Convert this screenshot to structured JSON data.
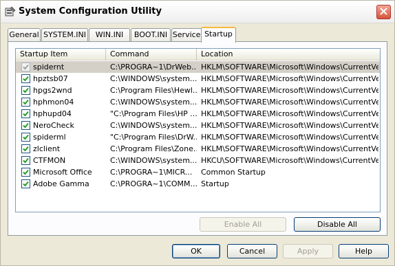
{
  "window": {
    "title": "System Configuration Utility",
    "app_icon": "msconfig-icon",
    "close_icon": "close-icon",
    "close_color": "#d6543b"
  },
  "tabs": [
    {
      "label": "General",
      "active": false
    },
    {
      "label": "SYSTEM.INI",
      "active": false
    },
    {
      "label": "WIN.INI",
      "active": false
    },
    {
      "label": "BOOT.INI",
      "active": false
    },
    {
      "label": "Services",
      "active": false
    },
    {
      "label": "Startup",
      "active": true
    }
  ],
  "startup": {
    "columns": {
      "item": "Startup Item",
      "command": "Command",
      "location": "Location"
    },
    "rows": [
      {
        "item": "spidernt",
        "command": "C:\\PROGRA~1\\DrWeb...",
        "location": "HKLM\\SOFTWARE\\Microsoft\\Windows\\CurrentVer...",
        "checked": true,
        "selected": true
      },
      {
        "item": "hpztsb07",
        "command": "C:\\WINDOWS\\system...",
        "location": "HKLM\\SOFTWARE\\Microsoft\\Windows\\CurrentVer...",
        "checked": true,
        "selected": false
      },
      {
        "item": "hpgs2wnd",
        "command": "C:\\Program Files\\Hewl...",
        "location": "HKLM\\SOFTWARE\\Microsoft\\Windows\\CurrentVer...",
        "checked": true,
        "selected": false
      },
      {
        "item": "hphmon04",
        "command": "C:\\WINDOWS\\system...",
        "location": "HKLM\\SOFTWARE\\Microsoft\\Windows\\CurrentVer...",
        "checked": true,
        "selected": false
      },
      {
        "item": "hphupd04",
        "command": "\"C:\\Program Files\\HP ...",
        "location": "HKLM\\SOFTWARE\\Microsoft\\Windows\\CurrentVer...",
        "checked": true,
        "selected": false
      },
      {
        "item": "NeroCheck",
        "command": "C:\\WINDOWS\\system...",
        "location": "HKLM\\SOFTWARE\\Microsoft\\Windows\\CurrentVer...",
        "checked": true,
        "selected": false
      },
      {
        "item": "spiderml",
        "command": "\"C:\\Program Files\\DrW...",
        "location": "HKLM\\SOFTWARE\\Microsoft\\Windows\\CurrentVer...",
        "checked": true,
        "selected": false
      },
      {
        "item": "zlclient",
        "command": "C:\\Program Files\\Zone...",
        "location": "HKLM\\SOFTWARE\\Microsoft\\Windows\\CurrentVer...",
        "checked": true,
        "selected": false
      },
      {
        "item": "CTFMON",
        "command": "C:\\WINDOWS\\system...",
        "location": "HKCU\\SOFTWARE\\Microsoft\\Windows\\CurrentVer...",
        "checked": true,
        "selected": false
      },
      {
        "item": "Microsoft Office",
        "command": "C:\\PROGRA~1\\MICR...",
        "location": "Common Startup",
        "checked": true,
        "selected": false
      },
      {
        "item": "Adobe Gamma",
        "command": "C:\\PROGRA~1\\COMM...",
        "location": "Startup",
        "checked": true,
        "selected": false
      }
    ],
    "enable_all_label": "Enable All",
    "disable_all_label": "Disable All"
  },
  "footer": {
    "ok_label": "OK",
    "cancel_label": "Cancel",
    "apply_label": "Apply",
    "help_label": "Help"
  },
  "colors": {
    "window_bg": "#ece9d8",
    "active_tab_accent": "#f6b83c",
    "selected_row": "#d4d0c8",
    "check_mark": "#21a121",
    "button_border": "#003c74"
  }
}
